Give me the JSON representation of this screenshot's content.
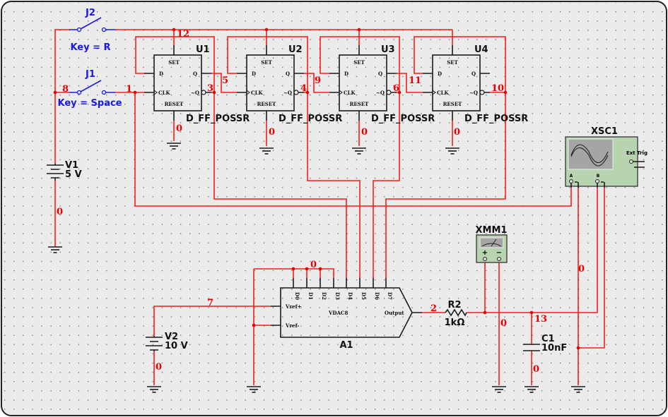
{
  "colors": {
    "wire": "#ff1a1a",
    "switch": "#1a1ae6",
    "component": "#1a1a1a",
    "instrument": "#b7d3b0",
    "background": "#ebebeb"
  },
  "switches": {
    "j2": {
      "name": "J2",
      "key": "Key = R"
    },
    "j1": {
      "name": "J1",
      "key": "Key = Space"
    }
  },
  "sources": {
    "v1": {
      "name": "V1",
      "value": "5 V"
    },
    "v2": {
      "name": "V2",
      "value": "10 V"
    }
  },
  "flipflops": {
    "model": "D_FF_POSSR",
    "pins": {
      "set": "SET",
      "d": "D",
      "q": "Q",
      "clk": "CLK",
      "qbar": "~Q",
      "reset": "RESET"
    },
    "units": [
      {
        "name": "U1"
      },
      {
        "name": "U2"
      },
      {
        "name": "U3"
      },
      {
        "name": "U4"
      }
    ]
  },
  "dac": {
    "name": "A1",
    "type": "VDAC8",
    "pins": [
      "D0",
      "D1",
      "D2",
      "D3",
      "D4",
      "D5",
      "D6",
      "D7"
    ],
    "vref_plus": "Vref+",
    "vref_minus": "Vref-",
    "output": "Output"
  },
  "resistor": {
    "name": "R2",
    "value": "1kΩ"
  },
  "capacitor": {
    "name": "C1",
    "value": "10nF"
  },
  "multimeter": {
    "name": "XMM1",
    "plus": "+",
    "minus": "−"
  },
  "oscilloscope": {
    "name": "XSC1",
    "channel_a": "A",
    "channel_b": "B",
    "ext_trig": "Ext Trig"
  },
  "nets": {
    "n8": "8",
    "n1": "1",
    "n12": "12",
    "n3": "3",
    "n5": "5",
    "n4": "4",
    "n9": "9",
    "n6": "6",
    "n11": "11",
    "n10": "10",
    "n7": "7",
    "n2": "2",
    "n13": "13",
    "gnd": "0"
  }
}
